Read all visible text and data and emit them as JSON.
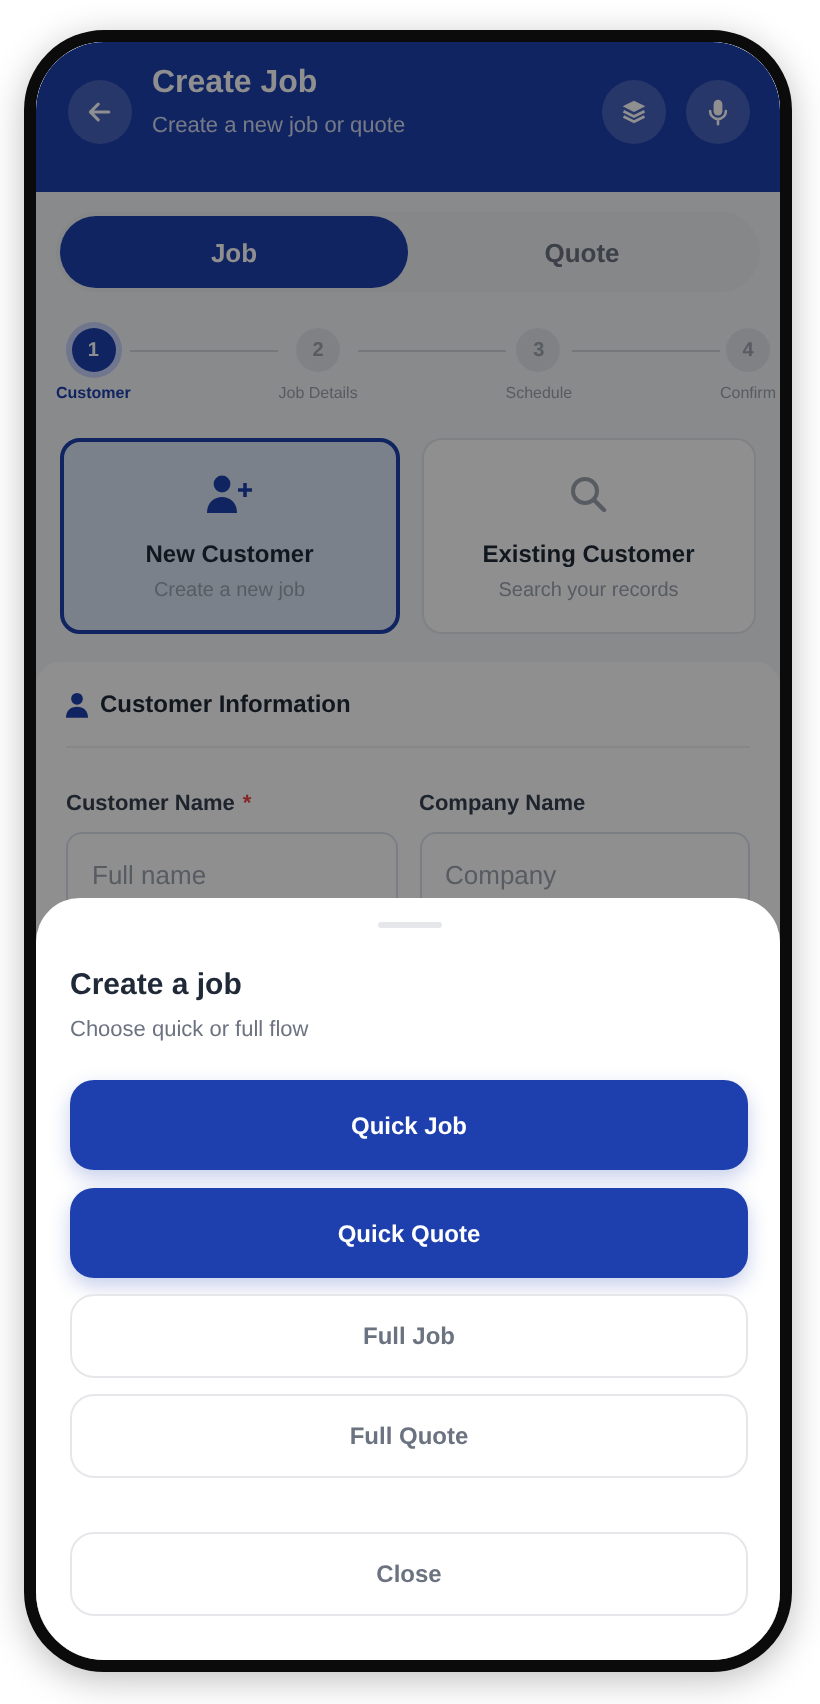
{
  "header": {
    "title": "Create Job",
    "subtitle": "Create a new job or quote",
    "actions": [
      {
        "kind": "layers"
      },
      {
        "kind": "mic"
      }
    ]
  },
  "tabs": [
    {
      "label": "Job",
      "selected": true
    },
    {
      "label": "Quote",
      "selected": false
    }
  ],
  "steps": [
    {
      "number": "1",
      "label": "Customer",
      "selected": true
    },
    {
      "number": "2",
      "label": "Job Details",
      "selected": false
    },
    {
      "number": "3",
      "label": "Schedule",
      "selected": false
    },
    {
      "number": "4",
      "label": "Confirm",
      "selected": false
    }
  ],
  "customer_options": [
    {
      "kind": "new",
      "title": "New Customer",
      "subtitle": "Create a new job",
      "selected": true
    },
    {
      "kind": "search",
      "title": "Existing Customer",
      "subtitle": "Search your records",
      "selected": false
    }
  ],
  "section": {
    "title": "Customer Information",
    "fields": [
      {
        "label": "Customer Name",
        "required_mark": "*",
        "placeholder": "Full name"
      },
      {
        "label": "Company Name",
        "placeholder": "Company"
      }
    ]
  },
  "sheet": {
    "title": "Create a job",
    "subtitle": "Choose quick or full flow",
    "actions": [
      {
        "label": "Quick Job",
        "kind": "primary"
      },
      {
        "label": "Quick Quote",
        "kind": "primary"
      },
      {
        "label": "Full Job",
        "kind": "secondary"
      },
      {
        "label": "Full Quote",
        "kind": "secondary"
      }
    ],
    "close": "Close"
  }
}
